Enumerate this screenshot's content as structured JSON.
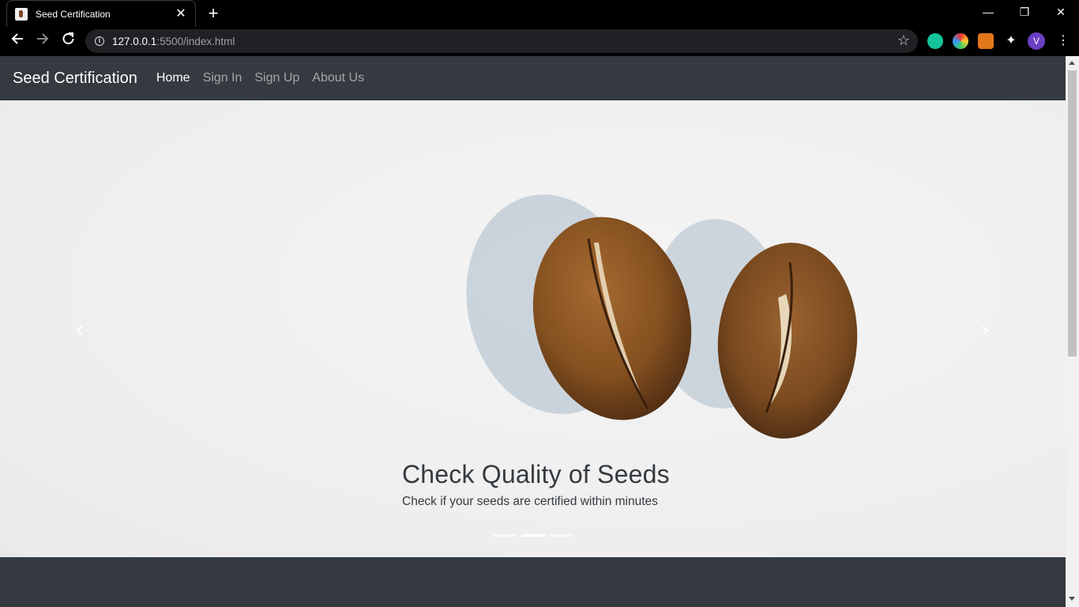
{
  "browser": {
    "tab_title": "Seed Certification",
    "tab_close": "✕",
    "new_tab": "+",
    "url_host": "127.0.0.1",
    "url_rest": ":5500/index.html",
    "window": {
      "minimize": "—",
      "restore": "❐",
      "close": "✕"
    },
    "profile_initial": "V",
    "icons": [
      "back-arrow-icon",
      "forward-arrow-icon",
      "reload-icon",
      "info-icon",
      "star-icon",
      "grammarly-icon",
      "colorful-extension-icon",
      "metamask-icon",
      "puzzle-icon",
      "menu-dots-icon"
    ]
  },
  "navbar": {
    "brand": "Seed Certification",
    "links": [
      {
        "label": "Home",
        "active": true
      },
      {
        "label": "Sign In",
        "active": false
      },
      {
        "label": "Sign Up",
        "active": false
      },
      {
        "label": "About Us",
        "active": false
      }
    ]
  },
  "carousel": {
    "title": "Check Quality of Seeds",
    "text": "Check if your seeds are certified within minutes",
    "prev": "‹",
    "next": "›",
    "indicators": 3,
    "active_indicator": 1,
    "image": "two-coffee-beans-on-white"
  },
  "colors": {
    "navbar_bg": "#343a40",
    "nav_active": "#ffffff",
    "nav_inactive": "rgba(255,255,255,0.55)",
    "profile": "#6a3fc4"
  }
}
